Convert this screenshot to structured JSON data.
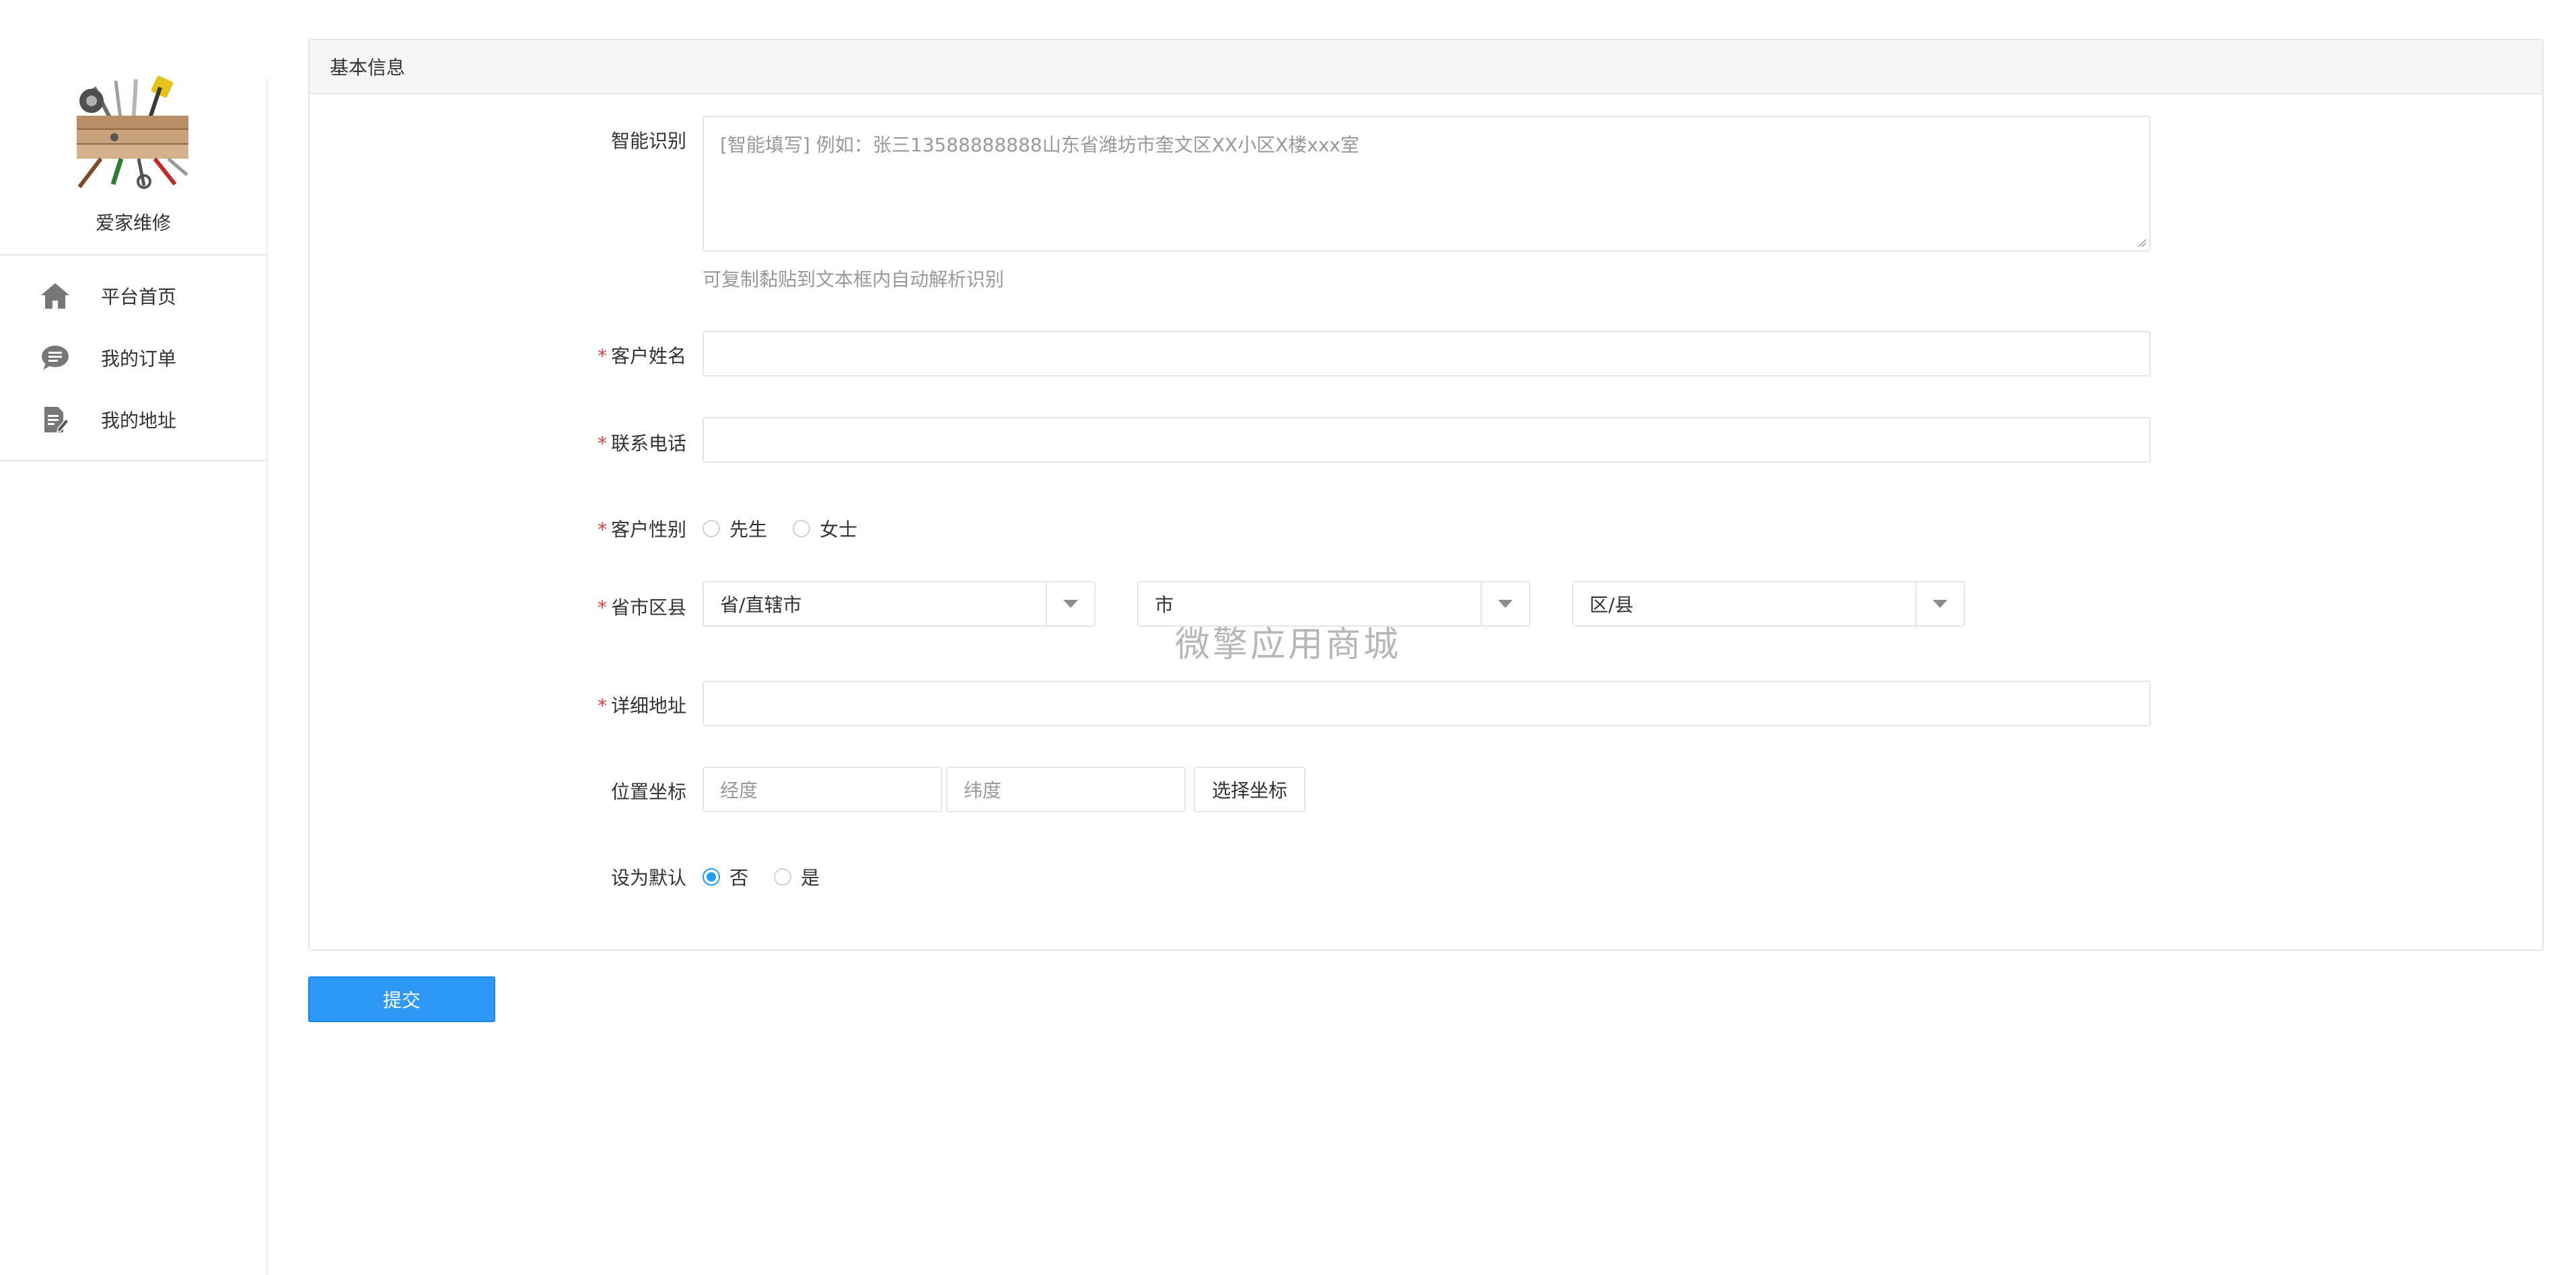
{
  "sidebar": {
    "brand": "爱家维修",
    "items": [
      {
        "label": "平台首页",
        "icon": "home-icon"
      },
      {
        "label": "我的订单",
        "icon": "chat-icon"
      },
      {
        "label": "我的地址",
        "icon": "edit-doc-icon"
      }
    ]
  },
  "panel": {
    "title": "基本信息"
  },
  "form": {
    "smart_label": "智能识别",
    "smart_placeholder": "[智能填写] 例如：张三13588888888山东省潍坊市奎文区XX小区X楼xxx室",
    "smart_hint": "可复制黏贴到文本框内自动解析识别",
    "required_mark": "*",
    "name_label": "客户姓名",
    "name_value": "",
    "phone_label": "联系电话",
    "phone_value": "",
    "gender_label": "客户性别",
    "gender_options": [
      "先生",
      "女士"
    ],
    "region_label": "省市区县",
    "province_placeholder": "省/直辖市",
    "city_placeholder": "市",
    "district_placeholder": "区/县",
    "address_label": "详细地址",
    "address_value": "",
    "coord_label": "位置坐标",
    "lng_placeholder": "经度",
    "lat_placeholder": "纬度",
    "pick_coord_button": "选择坐标",
    "default_label": "设为默认",
    "default_options": [
      "否",
      "是"
    ],
    "default_selected": "否"
  },
  "watermark": "微擎应用商城",
  "submit_label": "提交",
  "colors": {
    "accent": "#2d98f6",
    "radio_checked": "#1e9fff",
    "required": "#e4393c",
    "border": "#e6e6e6"
  }
}
